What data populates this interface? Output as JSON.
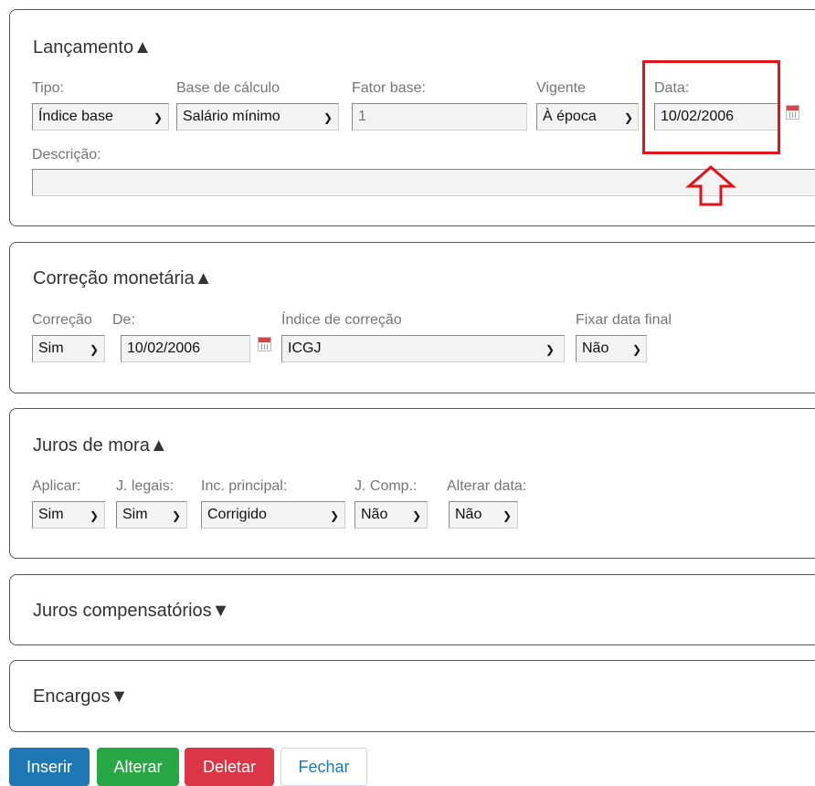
{
  "lancamento": {
    "title": "Lançamento",
    "toggle": "▲",
    "tipo": {
      "label": "Tipo:",
      "value": "Índice base"
    },
    "base_calculo": {
      "label": "Base de cálculo",
      "value": "Salário mínimo"
    },
    "fator_base": {
      "label": "Fator base:",
      "value": "1"
    },
    "vigente": {
      "label": "Vigente",
      "value": "À época"
    },
    "data": {
      "label": "Data:",
      "value": "10/02/2006"
    },
    "descricao": {
      "label": "Descrição:",
      "value": ""
    }
  },
  "correcao": {
    "title": "Correção monetária",
    "toggle": "▲",
    "correcao": {
      "label": "Correção",
      "value": "Sim"
    },
    "de": {
      "label": "De:",
      "value": "10/02/2006"
    },
    "indice": {
      "label": "Índice de correção",
      "value": "ICGJ"
    },
    "fixar": {
      "label": "Fixar data final",
      "value": "Não"
    }
  },
  "juros_mora": {
    "title": "Juros de mora",
    "toggle": "▲",
    "aplicar": {
      "label": "Aplicar:",
      "value": "Sim"
    },
    "legais": {
      "label": "J. legais:",
      "value": "Sim"
    },
    "principal": {
      "label": "Inc. principal:",
      "value": "Corrigido"
    },
    "comp": {
      "label": "J. Comp.:",
      "value": "Não"
    },
    "alterar": {
      "label": "Alterar data:",
      "value": "Não"
    }
  },
  "juros_comp": {
    "title": "Juros compensatórios",
    "toggle": "▼"
  },
  "encargos": {
    "title": "Encargos",
    "toggle": "▼"
  },
  "buttons": {
    "inserir": "Inserir",
    "alterar": "Alterar",
    "deletar": "Deletar",
    "fechar": "Fechar"
  },
  "colors": {
    "inserir": "#1f78b4",
    "alterar": "#28a745",
    "deletar": "#dc3545",
    "highlight": "#e0131a"
  }
}
